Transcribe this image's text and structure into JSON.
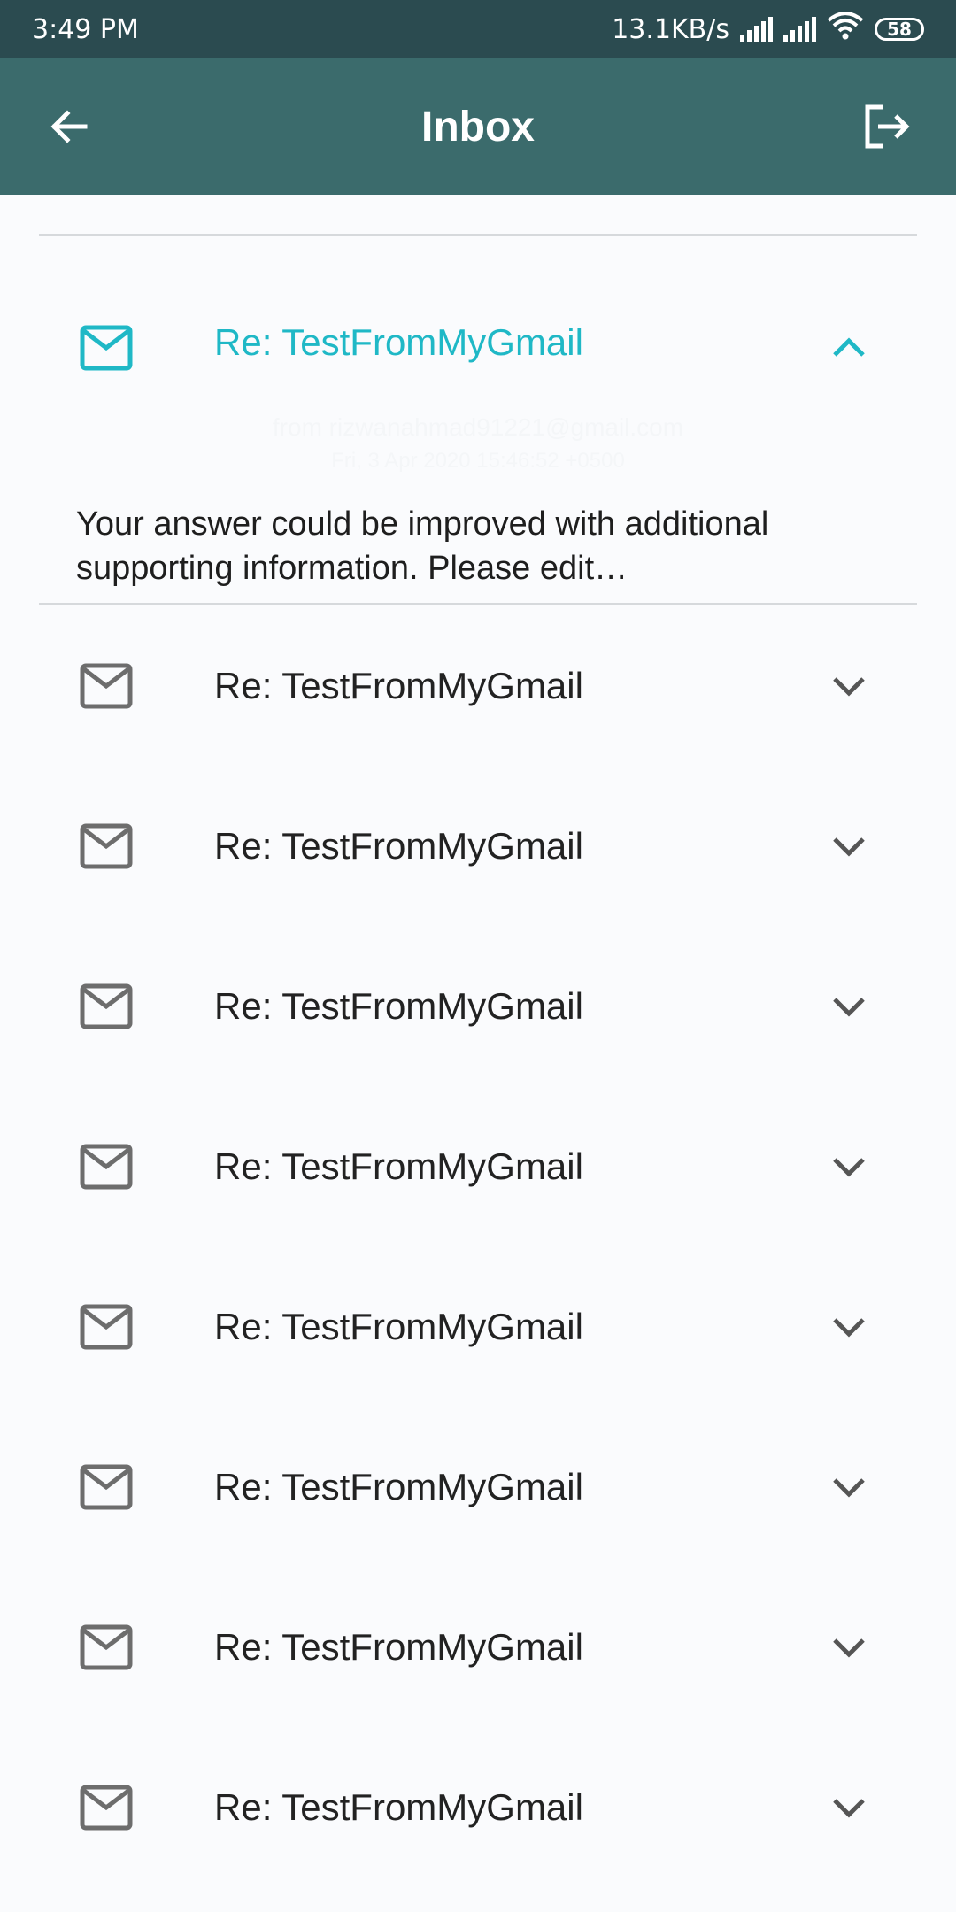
{
  "status_bar": {
    "time": "3:49 PM",
    "net_speed": "13.1KB/s",
    "battery": "58"
  },
  "app_bar": {
    "title": "Inbox",
    "back_icon": "arrow-back-icon",
    "logout_icon": "logout-icon"
  },
  "colors": {
    "app_bar": "#3b6b6c",
    "status_bar": "#2b4b50",
    "accent": "#1fb8c6"
  },
  "emails": [
    {
      "subject": "Re: TestFromMyGmail",
      "expanded": true,
      "from": "from rizwanahmad91221@gmail.com",
      "date": "Fri, 3 Apr 2020 15:46:52 +0500",
      "preview": "Your answer could be improved with additional supporting information. Please edit…"
    },
    {
      "subject": "Re: TestFromMyGmail",
      "expanded": false
    },
    {
      "subject": "Re: TestFromMyGmail",
      "expanded": false
    },
    {
      "subject": "Re: TestFromMyGmail",
      "expanded": false
    },
    {
      "subject": "Re: TestFromMyGmail",
      "expanded": false
    },
    {
      "subject": "Re: TestFromMyGmail",
      "expanded": false
    },
    {
      "subject": "Re: TestFromMyGmail",
      "expanded": false
    },
    {
      "subject": "Re: TestFromMyGmail",
      "expanded": false
    },
    {
      "subject": "Re: TestFromMyGmail",
      "expanded": false
    }
  ]
}
